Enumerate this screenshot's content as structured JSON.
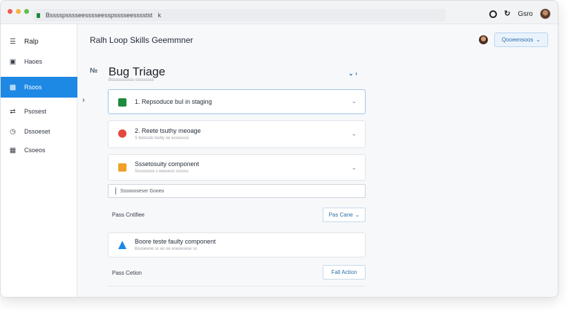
{
  "browser": {
    "url": "Bsssspsssseesssseesspsssseesssstst",
    "right_label": "Gsro"
  },
  "colors": {
    "accent": "#1e88e5",
    "dot_red": "#ee5c52",
    "dot_yellow": "#f4b63f",
    "dot_green": "#5fc04b"
  },
  "sidebar": {
    "items": [
      {
        "label": "Ralp",
        "icon": "menu-icon"
      },
      {
        "label": "Haoes",
        "icon": "home-icon"
      },
      {
        "label": "Rsoos",
        "icon": "document-icon"
      },
      {
        "label": "Psosest",
        "icon": "arrows-icon"
      },
      {
        "label": "Dssoeset",
        "icon": "clock-icon"
      },
      {
        "label": "Csoeos",
        "icon": "grid-icon"
      }
    ]
  },
  "header": {
    "title": "Ralh Loop Skills Geemmner",
    "select_label": "Qooeensoos"
  },
  "page": {
    "title": "Bug Triage",
    "subtitle": "Bsssssssssss sssssssss"
  },
  "steps": [
    {
      "title": "1. Repsoduce buI in staging",
      "subtitle": ""
    },
    {
      "title": "2. Reete tsuthy meoage",
      "subtitle": "S botsodo tsetty oe eosessso"
    },
    {
      "title": "Sssetosuity component",
      "subtitle": "Sssssosos s eeeseso sssoss"
    }
  ],
  "note_input": {
    "value": "Sssoooseser Gooeo"
  },
  "pass_criteria": {
    "label": "Pass Cntifiee",
    "button": "Pas Cane"
  },
  "result_card": {
    "title": "Boore teste faulty component",
    "subtitle": "Boooeeoe ss eo oe eseseoese ss"
  },
  "pass_action": {
    "label": "Pass Cetion",
    "button": "Fall Action"
  }
}
